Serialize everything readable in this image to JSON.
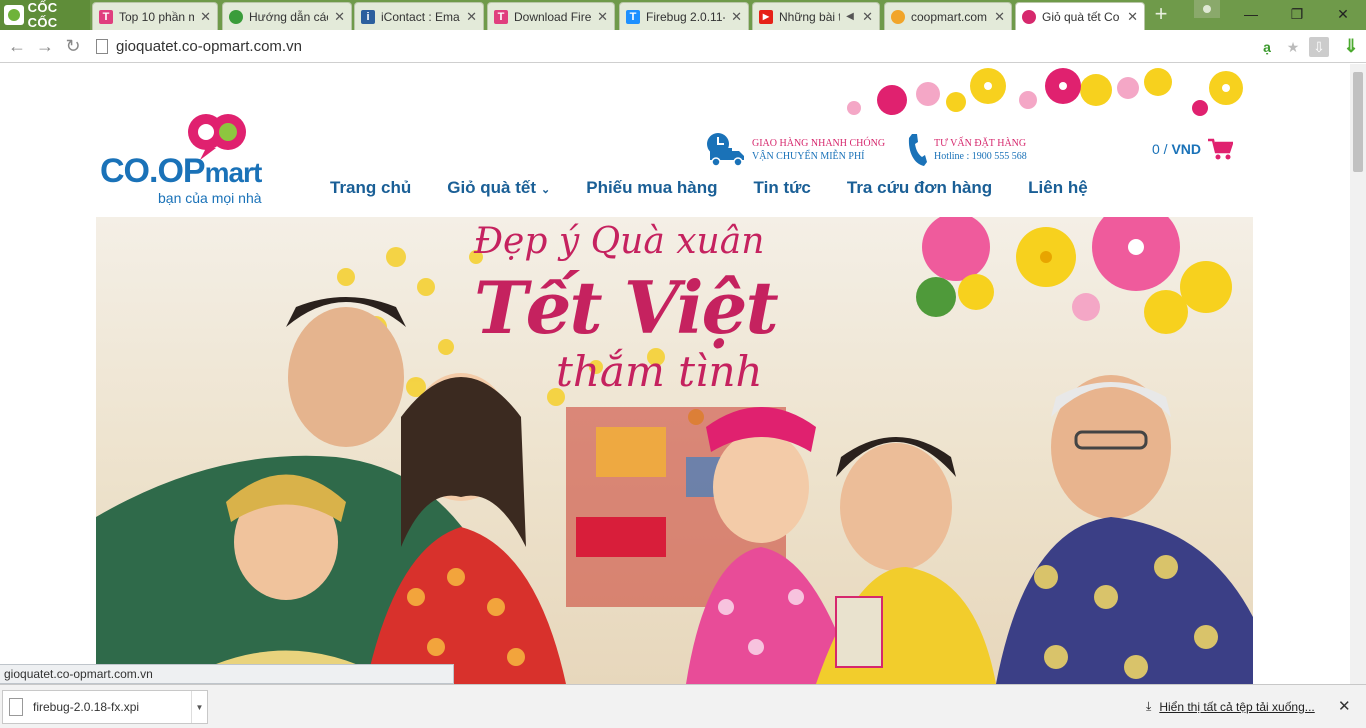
{
  "browser": {
    "brand": "CỐC CỐC",
    "tabs": [
      {
        "title": "Top 10 phần m",
        "favicon": "T",
        "favicon_color": "#e03e7e"
      },
      {
        "title": "Hướng dẫn các",
        "favicon": "",
        "favicon_color": "#3a9c3a"
      },
      {
        "title": "iContact : Emai",
        "favicon": "i",
        "favicon_color": "#2c5f9e"
      },
      {
        "title": "Download Firel",
        "favicon": "T",
        "favicon_color": "#e03e7e"
      },
      {
        "title": "Firebug 2.0.11-",
        "favicon": "T",
        "favicon_color": "#1e90ff"
      },
      {
        "title": "Những bài t",
        "favicon": "▶",
        "favicon_color": "#e62117"
      },
      {
        "title": "coopmart.com",
        "favicon": "",
        "favicon_color": "#f1a52a"
      },
      {
        "title": "Giỏ quà tết Co",
        "favicon": "",
        "favicon_color": "#d6286d"
      }
    ],
    "url": "gioquatet.co-opmart.com.vn",
    "accent": "#6f9a4a"
  },
  "site": {
    "logo": {
      "word1": "CO.OP",
      "word2": "mart",
      "tagline": "bạn của mọi nhà"
    },
    "services": [
      {
        "line1": "GIAO HÀNG NHANH CHÓNG",
        "line2": "VẬN CHUYỂN MIỄN PHÍ"
      },
      {
        "line1": "TƯ VẤN ĐẶT HÀNG",
        "line2": "Hotline :  1900 555 568"
      }
    ],
    "cart": {
      "amount": "0 /",
      "currency": "VND"
    },
    "nav": [
      "Trang chủ",
      "Giỏ quà tết",
      "Phiếu mua hàng",
      "Tin tức",
      "Tra cứu đơn hàng",
      "Liên hệ"
    ],
    "banner": {
      "line1": "Đẹp ý Quà xuân",
      "line2": "Tết Việt",
      "line3": "thắm tình"
    },
    "brand_pink": "#d6286d",
    "brand_blue": "#1a72b8"
  },
  "status_url": "gioquatet.co-opmart.com.vn",
  "downloads": {
    "file": "firebug-2.0.18-fx.xpi",
    "show_all": "Hiển thị tất cả tệp tải xuống..."
  }
}
